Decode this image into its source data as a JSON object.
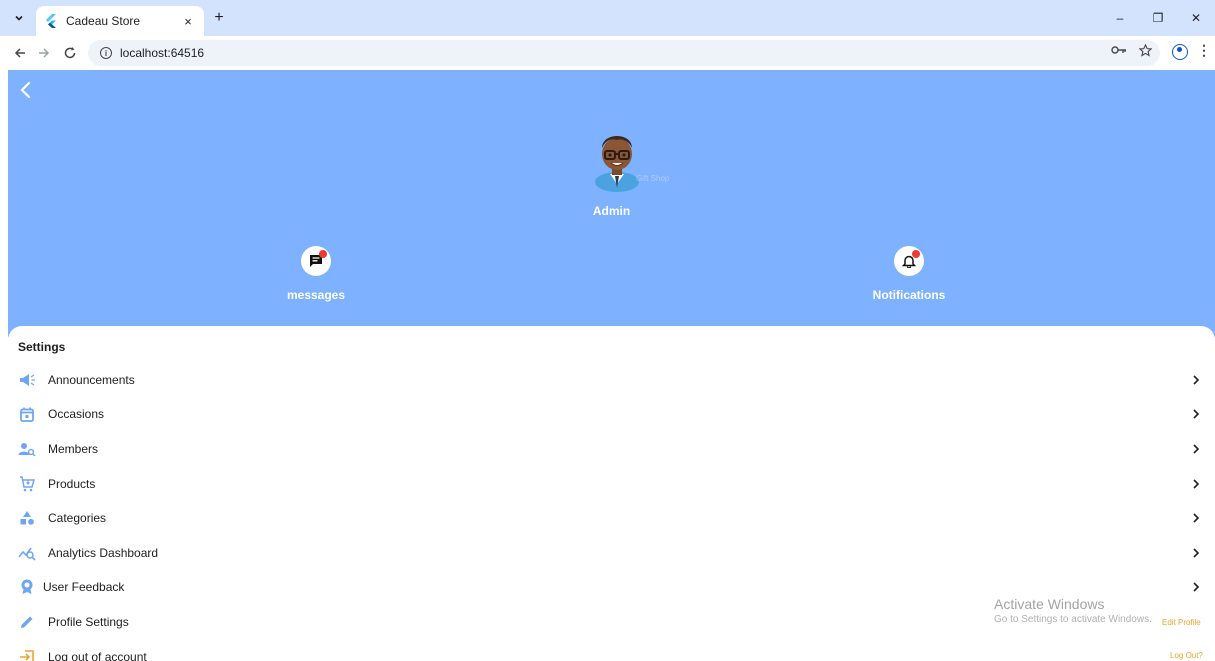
{
  "browser": {
    "tab_title": "Cadeau Store",
    "tab_close": "×",
    "new_tab": "+",
    "url": "localhost:64516",
    "window_controls": {
      "minimize": "–",
      "restore": "❐",
      "close": "✕"
    }
  },
  "header": {
    "avatar_overlay_text": "Gift Shop",
    "admin_name": "Admin",
    "quick_actions": [
      {
        "label": "messages",
        "icon": "chat-icon",
        "has_badge": true
      },
      {
        "label": "Notifications",
        "icon": "bell-icon",
        "has_badge": true
      }
    ]
  },
  "settings": {
    "title": "Settings",
    "items": [
      {
        "label": "Announcements",
        "icon": "megaphone-icon"
      },
      {
        "label": "Occasions",
        "icon": "calendar-icon"
      },
      {
        "label": "Members",
        "icon": "people-search-icon"
      },
      {
        "label": "Products",
        "icon": "cart-icon"
      },
      {
        "label": "Categories",
        "icon": "shapes-icon"
      },
      {
        "label": "Analytics Dashboard",
        "icon": "analytics-icon"
      },
      {
        "label": "User Feedback",
        "icon": "award-icon"
      },
      {
        "label": "Profile Settings",
        "icon": "pencil-icon"
      },
      {
        "label": "Log out of account",
        "icon": "logout-icon"
      }
    ]
  },
  "overlay": {
    "activate_title": "Activate Windows",
    "activate_sub": "Go to Settings to activate Windows.",
    "edit_profile": "Edit Profile",
    "log_out": "Log Out?"
  },
  "colors": {
    "header_bg": "#7eb1ff",
    "icon_blue": "#6fa6f4",
    "accent_orange": "#f1a32c",
    "badge_red": "#ee3a2f"
  }
}
